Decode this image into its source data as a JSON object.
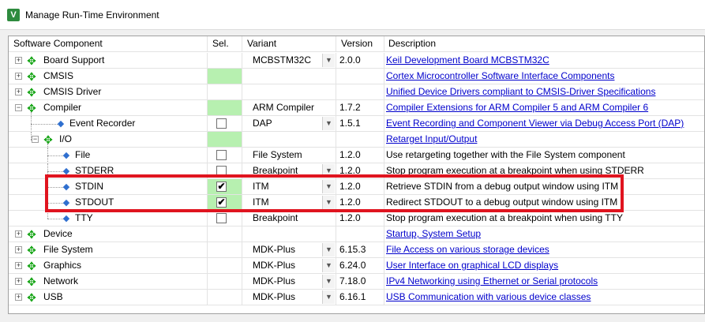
{
  "window": {
    "title": "Manage Run-Time Environment",
    "app_icon": "V"
  },
  "columns": {
    "component": "Software Component",
    "sel": "Sel.",
    "variant": "Variant",
    "version": "Version",
    "description": "Description"
  },
  "rows": [
    {
      "name": "Board Support",
      "variant": "MCBSTM32C",
      "version": "2.0.0",
      "desc": "Keil Development Board MCBSTM32C"
    },
    {
      "name": "CMSIS",
      "variant": "",
      "version": "",
      "desc": "Cortex Microcontroller Software Interface Components"
    },
    {
      "name": "CMSIS Driver",
      "variant": "",
      "version": "",
      "desc": "Unified Device Drivers compliant to CMSIS-Driver Specifications"
    },
    {
      "name": "Compiler",
      "variant": "ARM Compiler",
      "version": "1.7.2",
      "desc": "Compiler Extensions for ARM Compiler 5 and ARM Compiler 6"
    },
    {
      "name": "Event Recorder",
      "variant": "DAP",
      "version": "1.5.1",
      "desc": "Event Recording and Component Viewer via Debug Access Port (DAP)"
    },
    {
      "name": "I/O",
      "variant": "",
      "version": "",
      "desc": "Retarget Input/Output"
    },
    {
      "name": "File",
      "variant": "File System",
      "version": "1.2.0",
      "desc": "Use retargeting together with the File System component"
    },
    {
      "name": "STDERR",
      "variant": "Breakpoint",
      "version": "1.2.0",
      "desc": "Stop program execution at a breakpoint when using STDERR"
    },
    {
      "name": "STDIN",
      "variant": "ITM",
      "version": "1.2.0",
      "desc": "Retrieve STDIN from a debug output window using ITM",
      "checked": "✔"
    },
    {
      "name": "STDOUT",
      "variant": "ITM",
      "version": "1.2.0",
      "desc": "Redirect STDOUT to a debug output window using ITM",
      "checked": "✔"
    },
    {
      "name": "TTY",
      "variant": "Breakpoint",
      "version": "1.2.0",
      "desc": "Stop program execution at a breakpoint when using TTY"
    },
    {
      "name": "Device",
      "variant": "",
      "version": "",
      "desc": "Startup, System Setup"
    },
    {
      "name": "File System",
      "variant": "MDK-Plus",
      "version": "6.15.3",
      "desc": "File Access on various storage devices"
    },
    {
      "name": "Graphics",
      "variant": "MDK-Plus",
      "version": "6.24.0",
      "desc": "User Interface on graphical LCD displays"
    },
    {
      "name": "Network",
      "variant": "MDK-Plus",
      "version": "7.18.0",
      "desc": "IPv4 Networking using Ethernet or Serial protocols"
    },
    {
      "name": "USB",
      "variant": "MDK-Plus",
      "version": "6.16.1",
      "desc": "USB Communication with various device classes"
    }
  ],
  "colors": {
    "selected_green": "#b7f0b0",
    "link": "#0000cc",
    "highlight": "#e0141f",
    "component_green": "#12a312",
    "subcomponent_blue": "#2f6fcf"
  },
  "icons": {
    "expand": "+",
    "collapse": "−",
    "group": "✥",
    "leaf": "◆",
    "dropdown": "▼"
  }
}
